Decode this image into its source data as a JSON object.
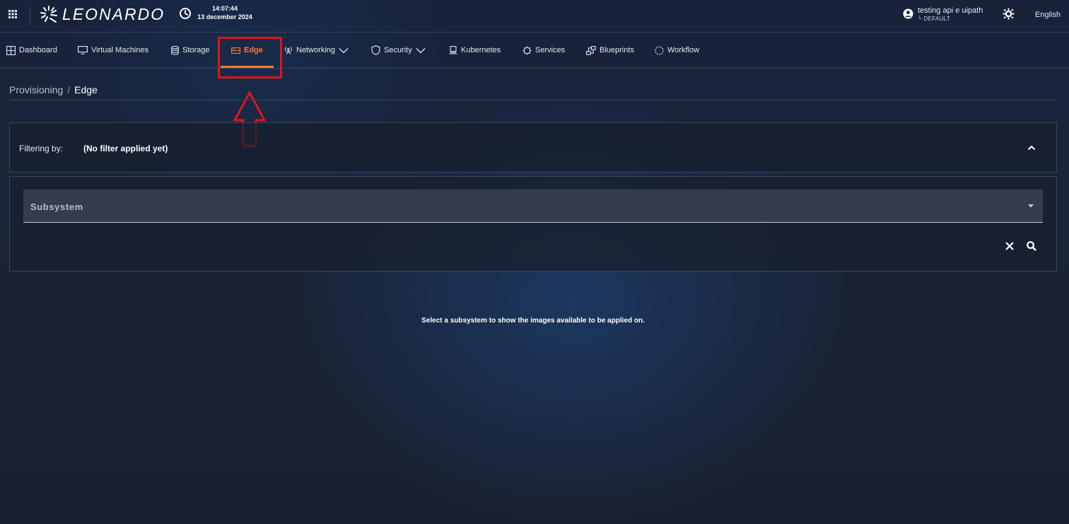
{
  "header": {
    "logo_text": "LEONARDO",
    "time": "14:07:44",
    "date": "13 december 2024",
    "user_name": "testing api e uipath",
    "user_tenant": "└ DEFAULT",
    "language": "English"
  },
  "nav": {
    "items": [
      {
        "label": "Dashboard",
        "icon": "dashboard-icon"
      },
      {
        "label": "Virtual Machines",
        "icon": "monitor-icon"
      },
      {
        "label": "Storage",
        "icon": "database-icon"
      },
      {
        "label": "Edge",
        "icon": "edge-icon",
        "active": true
      },
      {
        "label": "Networking",
        "icon": "antenna-icon",
        "has_dropdown": true
      },
      {
        "label": "Security",
        "icon": "shield-icon",
        "has_dropdown": true
      },
      {
        "label": "Kubernetes",
        "icon": "kubernetes-icon"
      },
      {
        "label": "Services",
        "icon": "gear-icon"
      },
      {
        "label": "Blueprints",
        "icon": "blueprints-icon"
      },
      {
        "label": "Workflow",
        "icon": "refresh-icon"
      }
    ]
  },
  "breadcrumb": {
    "parent": "Provisioning",
    "separator": "/",
    "current": "Edge"
  },
  "filter": {
    "label": "Filtering by:",
    "value": "(No filter applied yet)",
    "subsystem_label": "Subsystem"
  },
  "empty_message": "Select a subsystem to show the images available to be applied on.",
  "colors": {
    "accent": "#ff7a3d",
    "annotation": "#e0141c",
    "background": "#1a2438"
  }
}
